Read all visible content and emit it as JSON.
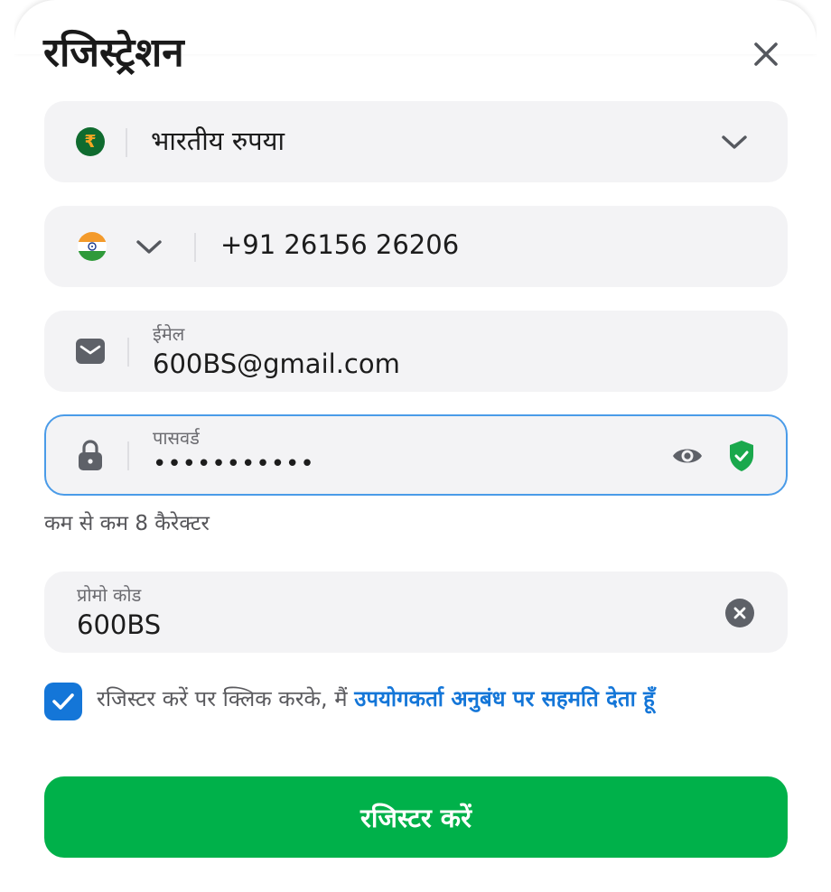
{
  "header": {
    "title": "रजिस्ट्रेशन"
  },
  "currency": {
    "symbol": "₹",
    "value": "भारतीय रुपया"
  },
  "phone": {
    "value": "+91 26156 26206"
  },
  "email": {
    "label": "ईमेल",
    "value": "600BS@gmail.com"
  },
  "password": {
    "label": "पासवर्ड",
    "value": "•••••••••••",
    "helper": "कम से कम 8 कैरेक्टर"
  },
  "promo": {
    "label": "प्रोमो कोड",
    "value": "600BS"
  },
  "agreement": {
    "checked": true,
    "text": "रजिस्टर करें पर क्लिक करके, मैं ",
    "link": "उपयोगकर्ता अनुबंध पर सहमति देता हूँ"
  },
  "submit": {
    "label": "रजिस्टर करें"
  },
  "colors": {
    "accent_blue": "#1476d8",
    "focus_border": "#4a9be8",
    "submit_green": "#00b14a",
    "shield_green": "#1aa84c",
    "field_bg": "#f3f3f5",
    "rupee_circle": "#0f6b2f",
    "rupee_symbol": "#f5a623"
  }
}
